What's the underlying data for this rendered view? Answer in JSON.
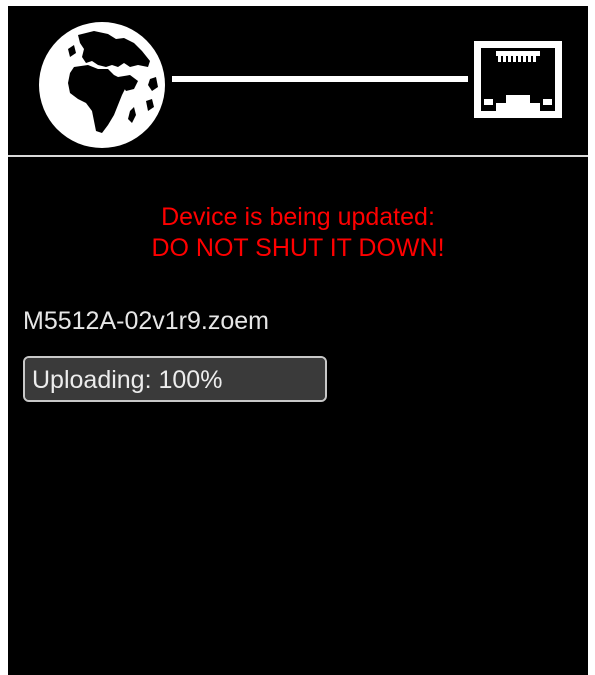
{
  "header": {
    "globe_icon": "globe-icon",
    "ethernet_icon": "ethernet-port-icon",
    "line_color": "#ffffff"
  },
  "warning": {
    "line1": "Device is being updated:",
    "line2": "DO NOT SHUT IT DOWN!",
    "color": "#ff0000"
  },
  "update": {
    "filename": "M5512A-02v1r9.zoem",
    "progress_label": "Uploading: 100%",
    "progress_fraction": 1.0
  }
}
